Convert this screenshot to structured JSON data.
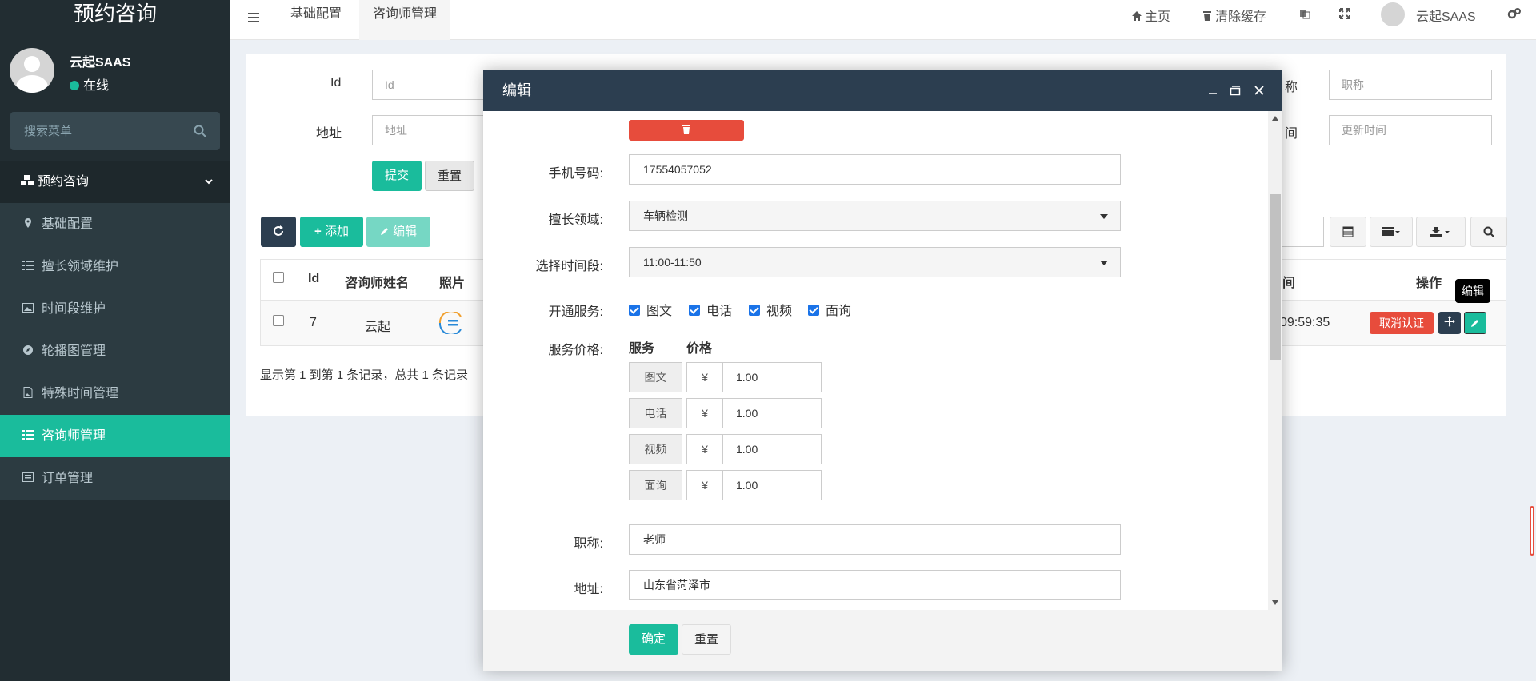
{
  "sidebar": {
    "brand": "预约咨询",
    "user_name": "云起SAAS",
    "user_status": "在线",
    "search_placeholder": "搜索菜单",
    "menu_header": "预约咨询",
    "items": [
      {
        "label": "基础配置",
        "icon": "map-marker-icon"
      },
      {
        "label": "擅长领域维护",
        "icon": "list-icon"
      },
      {
        "label": "时间段维护",
        "icon": "image-icon"
      },
      {
        "label": "轮播图管理",
        "icon": "compass-icon"
      },
      {
        "label": "特殊时间管理",
        "icon": "file-image-icon"
      },
      {
        "label": "咨询师管理",
        "icon": "list-icon",
        "active": true
      },
      {
        "label": "订单管理",
        "icon": "list-alt-icon"
      }
    ],
    "accent": "#1abc9c"
  },
  "navbar": {
    "tabs": [
      {
        "label": "基础配置"
      },
      {
        "label": "咨询师管理",
        "active": true
      }
    ],
    "home": "主页",
    "clear_cache": "清除缓存",
    "user": "云起SAAS"
  },
  "filter": {
    "id_label": "Id",
    "id_placeholder": "Id",
    "address_label": "地址",
    "address_placeholder": "地址",
    "title_label": "称",
    "title_placeholder": "职称",
    "update_label": "间",
    "update_placeholder": "更新时间",
    "submit": "提交",
    "reset": "重置"
  },
  "toolbar": {
    "add": "添加",
    "edit": "编辑"
  },
  "table": {
    "headers": {
      "id": "Id",
      "name": "咨询师姓名",
      "photo": "照片",
      "time": "间",
      "ops": "操作"
    },
    "rows": [
      {
        "id": "7",
        "name": "云起",
        "time": "09:59:35",
        "cancel": "取消认证"
      }
    ],
    "pagination": "显示第 1 到第 1 条记录，总共 1 条记录",
    "tooltip": "编辑"
  },
  "modal": {
    "title": "编辑",
    "phone_label": "手机号码:",
    "phone_value": "17554057052",
    "field_label": "擅长领域:",
    "field_value": "车辆检测",
    "timeslot_label": "选择时间段:",
    "timeslot_value": "11:00-11:50",
    "services_label": "开通服务:",
    "services": [
      "图文",
      "电话",
      "视频",
      "面询"
    ],
    "price_label": "服务价格:",
    "price_header_service": "服务",
    "price_header_price": "价格",
    "prices": [
      {
        "name": "图文",
        "currency": "¥",
        "value": "1.00"
      },
      {
        "name": "电话",
        "currency": "¥",
        "value": "1.00"
      },
      {
        "name": "视频",
        "currency": "¥",
        "value": "1.00"
      },
      {
        "name": "面询",
        "currency": "¥",
        "value": "1.00"
      }
    ],
    "title_label": "职称:",
    "title_value": "老师",
    "address_label": "地址:",
    "address_value": "山东省菏泽市",
    "confirm": "确定",
    "reset": "重置"
  }
}
